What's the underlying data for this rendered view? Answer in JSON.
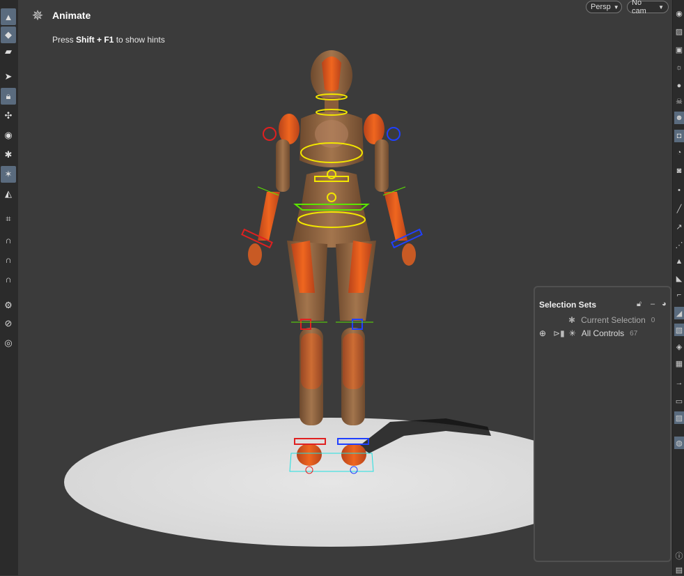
{
  "state": {
    "icon": "skeleton-icon",
    "title": "Animate"
  },
  "hint": {
    "prefix": "Press ",
    "keys": "Shift + F1",
    "suffix": " to show hints"
  },
  "viewport": {
    "camera_view": "Persp",
    "camera": "No cam"
  },
  "selection_sets": {
    "title": "Selection Sets",
    "items": [
      {
        "label": "Current Selection",
        "count": "0"
      },
      {
        "label": "All Controls",
        "count": "67"
      }
    ]
  },
  "colors": {
    "accent": "#5a6b7e",
    "mannequin": "#e65c1c",
    "wood": "#a0704a",
    "control_yellow": "#f2e600"
  }
}
